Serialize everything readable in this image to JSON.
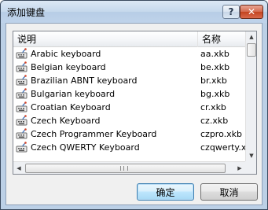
{
  "window": {
    "title": "添加键盘",
    "help_glyph": "?",
    "close_glyph": "✕"
  },
  "list": {
    "columns": {
      "description": "说明",
      "name": "名称"
    },
    "rows": [
      {
        "description": "Arabic keyboard",
        "name": "aa.xkb"
      },
      {
        "description": "Belgian keyboard",
        "name": "be.xkb"
      },
      {
        "description": "Brazilian ABNT keyboard",
        "name": "br.xkb"
      },
      {
        "description": "Bulgarian keyboard",
        "name": "bg.xkb"
      },
      {
        "description": "Croatian Keyboard",
        "name": "cr.xkb"
      },
      {
        "description": "Czech Keyboard",
        "name": "cz.xkb"
      },
      {
        "description": "Czech Programmer Keyboard",
        "name": "czpro.xkb"
      },
      {
        "description": "Czech QWERTY Keyboard",
        "name": "czqwerty.xkb"
      }
    ],
    "row_icon": "keyboard-icon"
  },
  "buttons": {
    "ok": "确定",
    "cancel": "取消"
  }
}
